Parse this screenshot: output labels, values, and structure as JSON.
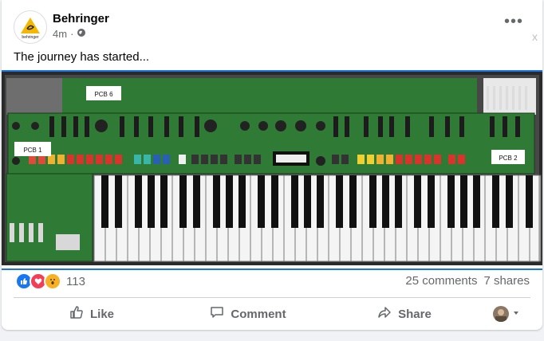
{
  "post": {
    "author": "Behringer",
    "time": "4m",
    "separator": "·",
    "text": "The journey has started...",
    "more_label": "•••",
    "close_label": "x"
  },
  "image_labels": {
    "pcb6": "PCB 6",
    "pcb1": "PCB 1",
    "pcb2": "PCB 2"
  },
  "engagement": {
    "reaction_count": "113",
    "comments": "25 comments",
    "shares": "7 shares"
  },
  "actions": {
    "like": "Like",
    "comment": "Comment",
    "share": "Share"
  },
  "colors": {
    "accent": "#1b74e4",
    "pcb_green": "#2f7a35",
    "like_blue": "#1877f2",
    "love_red": "#f33e58",
    "wow_yellow": "#f7b125"
  },
  "icons": [
    "globe-icon",
    "more-icon",
    "like-reaction-icon",
    "love-reaction-icon",
    "wow-reaction-icon",
    "thumbs-up-icon",
    "comment-icon",
    "share-icon",
    "chevron-down-icon"
  ]
}
